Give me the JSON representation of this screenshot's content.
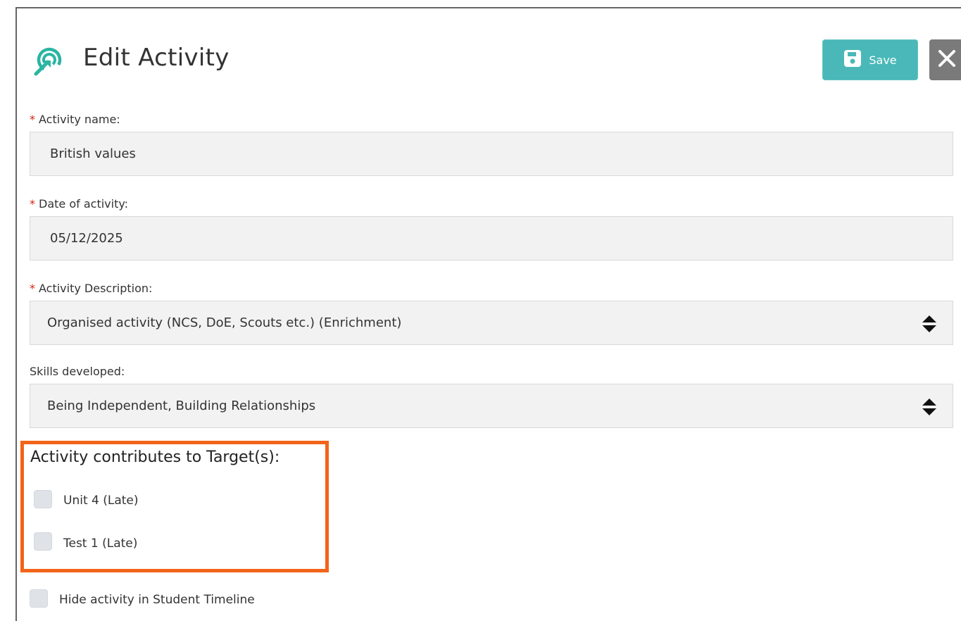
{
  "header": {
    "title": "Edit Activity",
    "save_label": "Save",
    "accent_color": "#4ab8b8",
    "icons": {
      "header": "activity-target-icon",
      "save": "floppy-disk-icon",
      "close": "close-x-icon"
    }
  },
  "form": {
    "required_marker": "*",
    "activity_name": {
      "label": "Activity name:",
      "value": "British values"
    },
    "date": {
      "label": "Date of activity:",
      "value": "05/12/2025"
    },
    "description": {
      "label": "Activity Description:",
      "value": "Organised activity (NCS, DoE, Scouts etc.) (Enrichment)"
    },
    "skills": {
      "label": "Skills developed:",
      "value": "Being Independent, Building Relationships"
    }
  },
  "targets": {
    "heading": "Activity contributes to Target(s):",
    "highlight_color": "#f26419",
    "items": [
      {
        "label": "Unit 4 (Late)",
        "checked": false
      },
      {
        "label": "Test 1 (Late)",
        "checked": false
      }
    ]
  },
  "hide_timeline": {
    "label": "Hide activity in Student Timeline",
    "checked": false
  }
}
